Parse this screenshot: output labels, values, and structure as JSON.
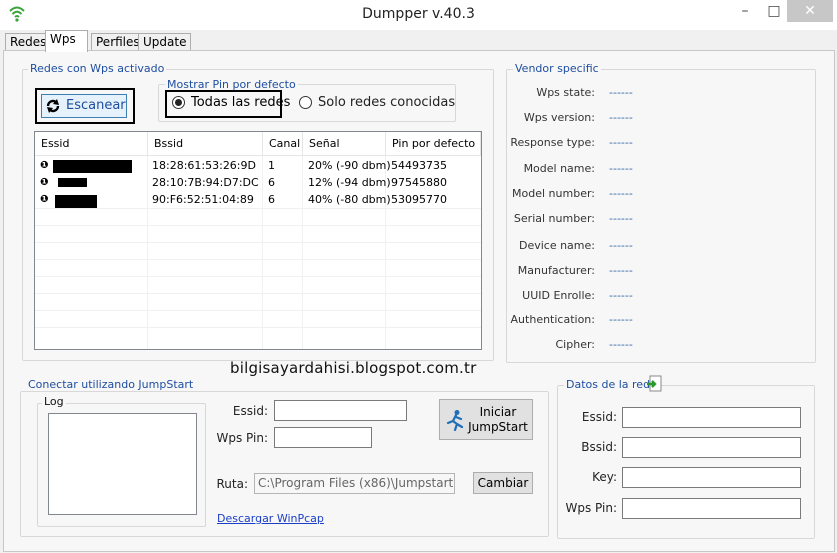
{
  "window": {
    "title": "Dumpper v.40.3",
    "minimize": "–",
    "maximize": "□",
    "close": "✕"
  },
  "tabs": [
    "Redes",
    "Wps",
    "Perfiles",
    "Update"
  ],
  "wps_group": {
    "label": "Redes con Wps activado",
    "scan_button": "Escanear",
    "pin_group_label": "Mostrar Pin por defecto",
    "radio_all": "Todas las redes",
    "radio_known": "Solo redes conocidas",
    "radio_selected": "all"
  },
  "table": {
    "columns": [
      "Essid",
      "Bssid",
      "Canal",
      "Señal",
      "Pin por defecto"
    ],
    "rows": [
      {
        "essid": "",
        "bssid": "18:28:61:53:26:9D",
        "canal": "1",
        "senal": "20% (-90 dbm)",
        "pin": "54493735"
      },
      {
        "essid": "",
        "bssid": "28:10:7B:94:D7:DC",
        "canal": "6",
        "senal": "12% (-94 dbm)",
        "pin": "97545880"
      },
      {
        "essid": "",
        "bssid": "90:F6:52:51:04:89",
        "canal": "6",
        "senal": "40% (-80 dbm)",
        "pin": "53095770"
      }
    ]
  },
  "vendor": {
    "label": "Vendor specific",
    "fields": [
      {
        "label": "Wps state:",
        "value": "------"
      },
      {
        "label": "Wps version:",
        "value": "------"
      },
      {
        "label": "Response type:",
        "value": "------"
      },
      {
        "label": "Model name:",
        "value": "------"
      },
      {
        "label": "Model number:",
        "value": "------"
      },
      {
        "label": "Serial number:",
        "value": "------"
      },
      {
        "label": "Device name:",
        "value": "------"
      },
      {
        "label": "Manufacturer:",
        "value": "------"
      },
      {
        "label": "UUID Enrolle:",
        "value": "------"
      },
      {
        "label": "Authentication:",
        "value": "------"
      },
      {
        "label": "Cipher:",
        "value": "------"
      }
    ]
  },
  "watermark": "bilgisayardahisi.blogspot.com.tr",
  "jumpstart": {
    "label": "Conectar utilizando JumpStart",
    "log_label": "Log",
    "essid_label": "Essid:",
    "wpspin_label": "Wps Pin:",
    "ruta_label": "Ruta:",
    "ruta_value": "C:\\Program Files (x86)\\Jumpstart",
    "start_button_line1": "Iniciar",
    "start_button_line2": "JumpStart",
    "cambiar_button": "Cambiar",
    "download_link": "Descargar WinPcap"
  },
  "red": {
    "label": "Datos de la red",
    "essid_label": "Essid:",
    "bssid_label": "Bssid:",
    "key_label": "Key:",
    "wpspin_label": "Wps Pin:"
  }
}
